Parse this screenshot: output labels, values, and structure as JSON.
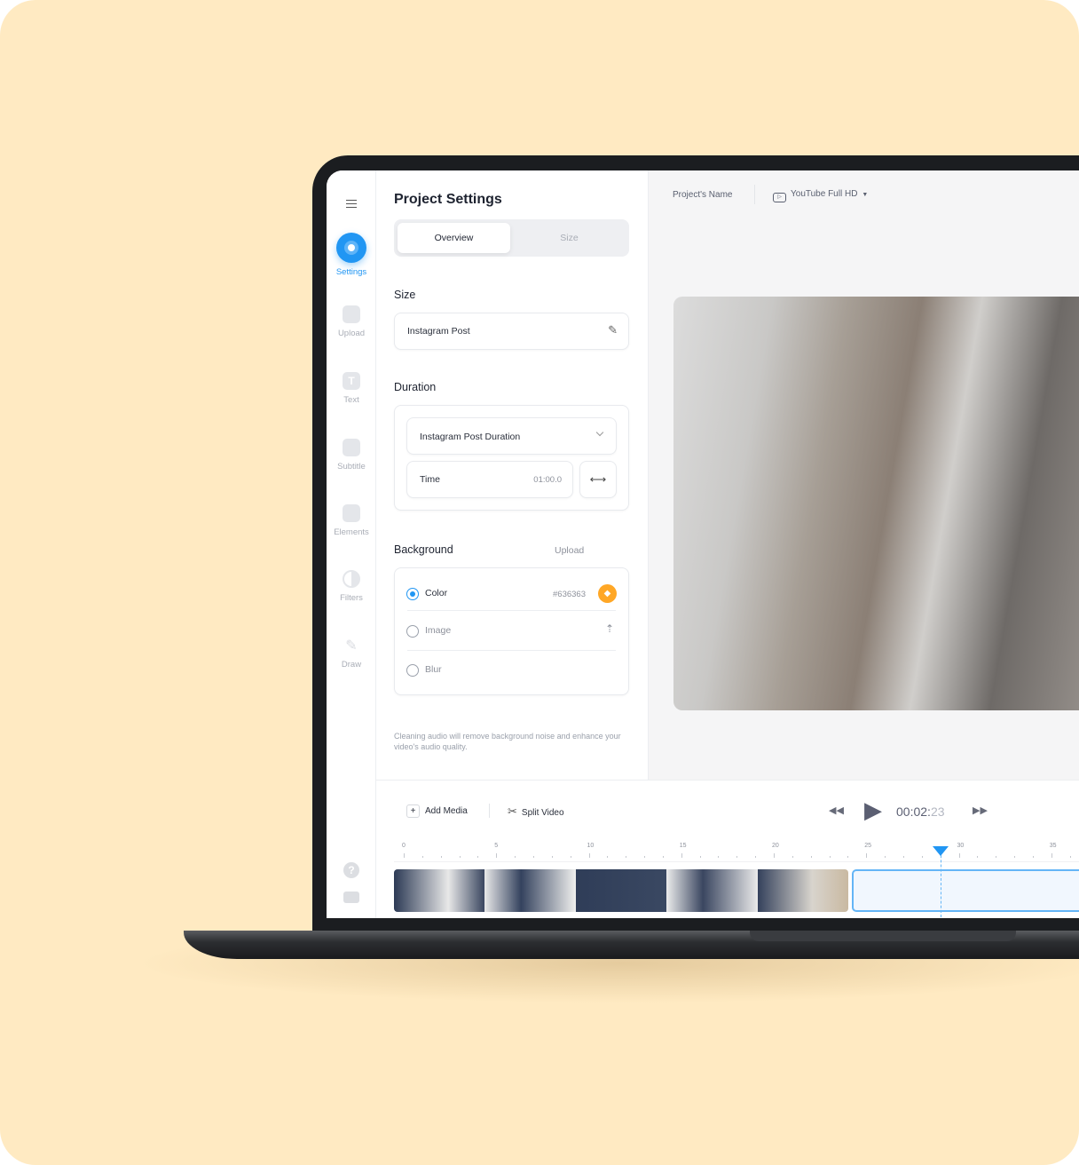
{
  "sidebar": {
    "items": [
      {
        "label": "Settings",
        "icon": "gear-icon",
        "active": true
      },
      {
        "label": "Upload",
        "icon": "image-icon"
      },
      {
        "label": "Text",
        "icon": "text-icon"
      },
      {
        "label": "Subtitle",
        "icon": "subtitle-icon"
      },
      {
        "label": "Elements",
        "icon": "sticker-icon"
      },
      {
        "label": "Filters",
        "icon": "filter-icon"
      },
      {
        "label": "Draw",
        "icon": "pencil-icon"
      }
    ]
  },
  "panel": {
    "title": "Project Settings",
    "tabs": [
      "Overview",
      "Size"
    ],
    "size_label": "Size",
    "size_value": "Instagram Post",
    "duration_label": "Duration",
    "duration_select": "Instagram Post Duration",
    "time_label": "Time",
    "time_value": "01:00.0",
    "background_label": "Background",
    "upload_link": "Upload",
    "options": [
      {
        "label": "Color",
        "value": "#636363",
        "selected": true
      },
      {
        "label": "Image"
      },
      {
        "label": "Blur"
      }
    ],
    "note": "Cleaning audio will remove background noise and enhance your video's audio quality."
  },
  "header": {
    "project_name": "Project's Name",
    "format": "YouTube Full HD"
  },
  "timeline": {
    "add_media": "Add Media",
    "split_video": "Split Video",
    "time_main": "00:02:",
    "time_frames": "23",
    "ticks": [
      "0",
      "5",
      "10",
      "15",
      "20",
      "25",
      "30",
      "35"
    ],
    "playhead_seconds": 29
  },
  "colors": {
    "accent": "#2196f3",
    "swatch": "#ffa726",
    "page_bg": "#ffeac2"
  }
}
